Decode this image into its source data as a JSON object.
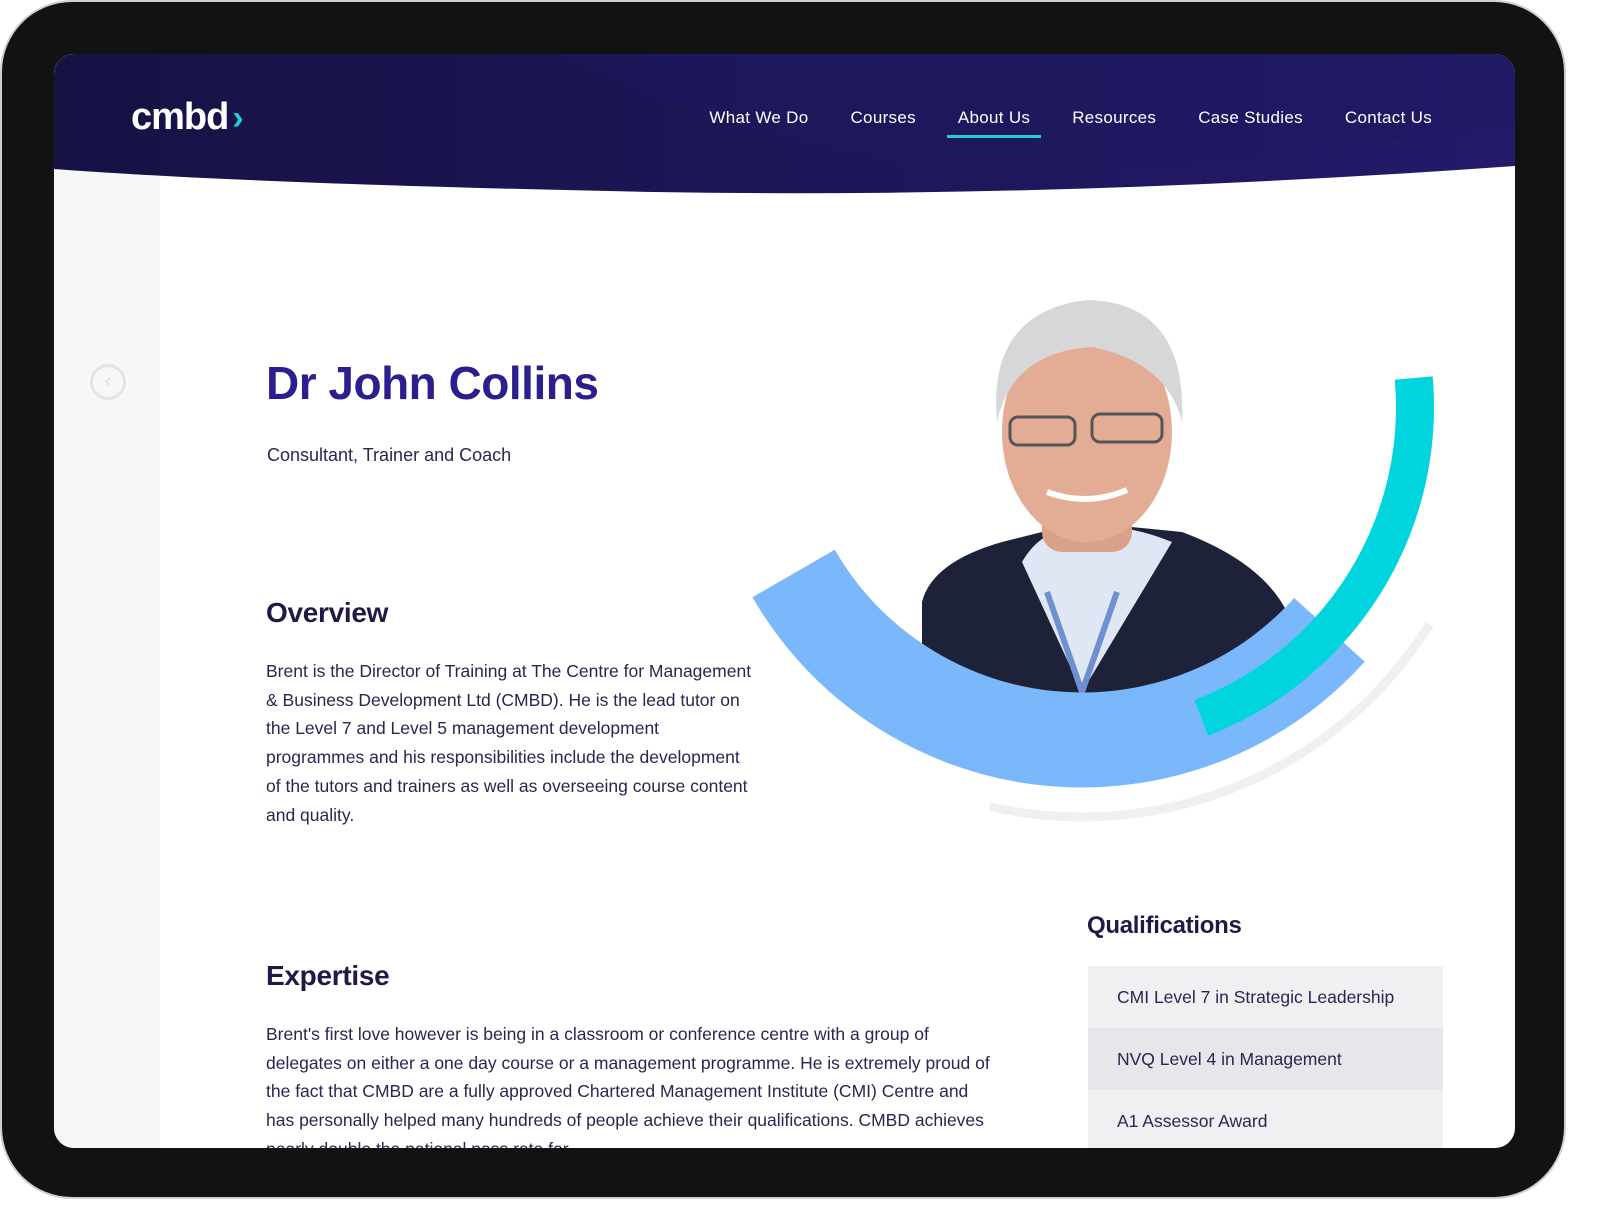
{
  "header": {
    "logo": "cmbd",
    "nav": [
      {
        "label": "What We Do"
      },
      {
        "label": "Courses"
      },
      {
        "label": "About Us",
        "active": true
      },
      {
        "label": "Resources"
      },
      {
        "label": "Case Studies"
      },
      {
        "label": "Contact Us"
      }
    ]
  },
  "profile": {
    "name": "Dr John Collins",
    "role": "Consultant, Trainer and Coach"
  },
  "overview": {
    "heading": "Overview",
    "text": "Brent is the Director of Training at The Centre for Management & Business Development Ltd (CMBD). He is the lead tutor on the Level 7 and Level 5 management development programmes and his responsibilities include the development of the tutors and trainers as well as overseeing course content and quality."
  },
  "expertise": {
    "heading": "Expertise",
    "text": "Brent's first love however is being in a classroom or conference centre with a group of delegates on either a one day course or a management programme. He is extremely proud of the fact that CMBD are a fully approved Chartered Management Institute (CMI) Centre and has personally helped many hundreds of people achieve their qualifications. CMBD achieves nearly double the national pass rate for"
  },
  "qualifications": {
    "heading": "Qualifications",
    "items": [
      "CMI Level 7 in Strategic Leadership",
      "NVQ Level 4 in Management",
      "A1 Assessor Award"
    ]
  },
  "colors": {
    "header": "#1b1548",
    "accent": "#1fd0db",
    "arc_blue": "#7ab8fb",
    "title": "#2b1f8f"
  },
  "icons": {
    "back": "chevron-left-circle-icon",
    "logo_chevron": "chevron-right-icon"
  }
}
